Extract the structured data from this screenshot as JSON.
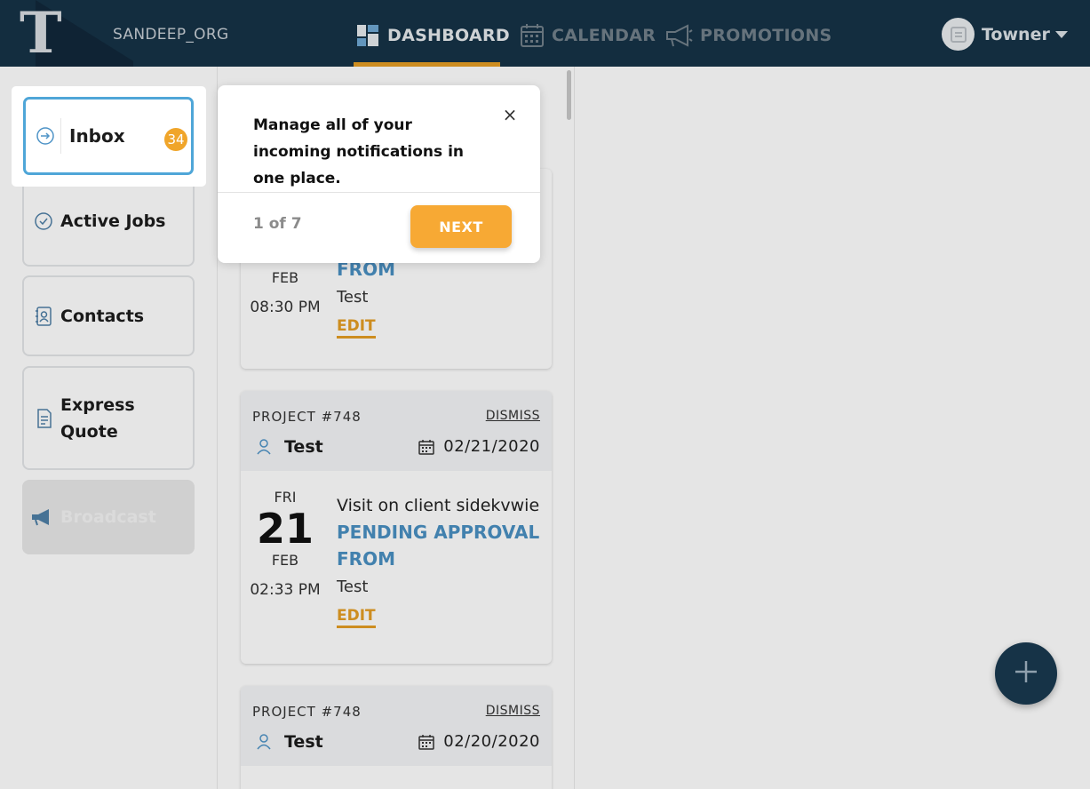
{
  "header": {
    "org_name": "SANDEEP_ORG",
    "nav": [
      {
        "label": "DASHBOARD",
        "icon": "dashboard-icon",
        "active": true
      },
      {
        "label": "CALENDAR",
        "icon": "calendar-icon",
        "active": false
      },
      {
        "label": "PROMOTIONS",
        "icon": "megaphone-icon",
        "active": false
      }
    ],
    "user": {
      "name": "Towner"
    },
    "accent_color": "#e59e24",
    "background_color": "#163347"
  },
  "sidebar": {
    "items": [
      {
        "label": "Inbox",
        "icon": "arrow-circle-icon",
        "badge": "34"
      },
      {
        "label": "Active Jobs",
        "icon": "check-circle-icon"
      },
      {
        "label": "Contacts",
        "icon": "contacts-book-icon"
      },
      {
        "label": "Express",
        "label2": "Quote",
        "icon": "quote-doc-icon"
      },
      {
        "label": "Broadcast",
        "icon": "megaphone-icon",
        "disabled": true
      }
    ]
  },
  "jobs": [
    {
      "month": "FEB",
      "time": "08:30 PM",
      "status": "FROM",
      "subtitle": "Test",
      "edit_label": "EDIT"
    },
    {
      "project": "PROJECT #748",
      "dismiss_label": "DISMISS",
      "client": "Test",
      "date": "02/21/2020",
      "day_name": "FRI",
      "day_num": "21",
      "month": "FEB",
      "time": "02:33 PM",
      "title": "Visit on client sidekvwie",
      "status_line1": "PENDING APPROVAL",
      "status_line2": "FROM",
      "subtitle": "Test",
      "edit_label": "EDIT"
    },
    {
      "project": "PROJECT #748",
      "dismiss_label": "DISMISS",
      "client": "Test",
      "date": "02/20/2020"
    }
  ],
  "tour": {
    "message": "Manage all of your incoming notifications in one place.",
    "close_symbol": "×",
    "step": "1 of 7",
    "next_label": "NEXT"
  },
  "fab": {
    "icon": "plus-icon"
  }
}
